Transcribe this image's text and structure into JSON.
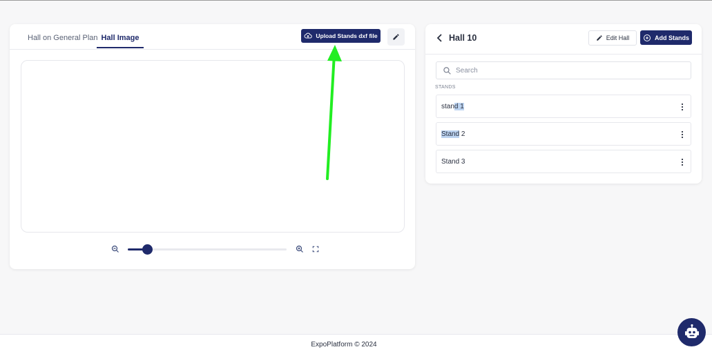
{
  "colors": {
    "primary": "#1f2a6b",
    "arrow": "#22ee22",
    "highlight": "#bcd3f0"
  },
  "left_panel": {
    "tabs": [
      {
        "label": "Hall on General Plan",
        "active": false
      },
      {
        "label": "Hall Image",
        "active": true
      }
    ],
    "upload_button": {
      "label": "Upload Stands dxf file",
      "icon": "cloud-upload-icon"
    },
    "edit_icon": "pencil-icon",
    "zoom": {
      "level": 0.12,
      "zoom_out_icon": "zoom-out-icon",
      "zoom_in_icon": "zoom-in-icon",
      "fullscreen_icon": "fullscreen-icon"
    }
  },
  "right_panel": {
    "title": "Hall 10",
    "back_icon": "chevron-left-icon",
    "edit_button": {
      "label": "Edit Hall",
      "icon": "pencil-icon"
    },
    "add_button": {
      "label": "Add Stands",
      "icon": "plus-circle-icon"
    },
    "search": {
      "placeholder": "Search",
      "value": ""
    },
    "section_label": "STANDS",
    "stands": [
      {
        "pre": "stan",
        "highlight": "d 1",
        "post": ""
      },
      {
        "pre": "",
        "highlight": "Stand",
        "post": " 2"
      },
      {
        "pre": "",
        "highlight": "",
        "post": "Stand 3"
      }
    ]
  },
  "footer": {
    "text": "ExpoPlatform © 2024"
  },
  "chatbot": {
    "icon": "robot-icon"
  }
}
